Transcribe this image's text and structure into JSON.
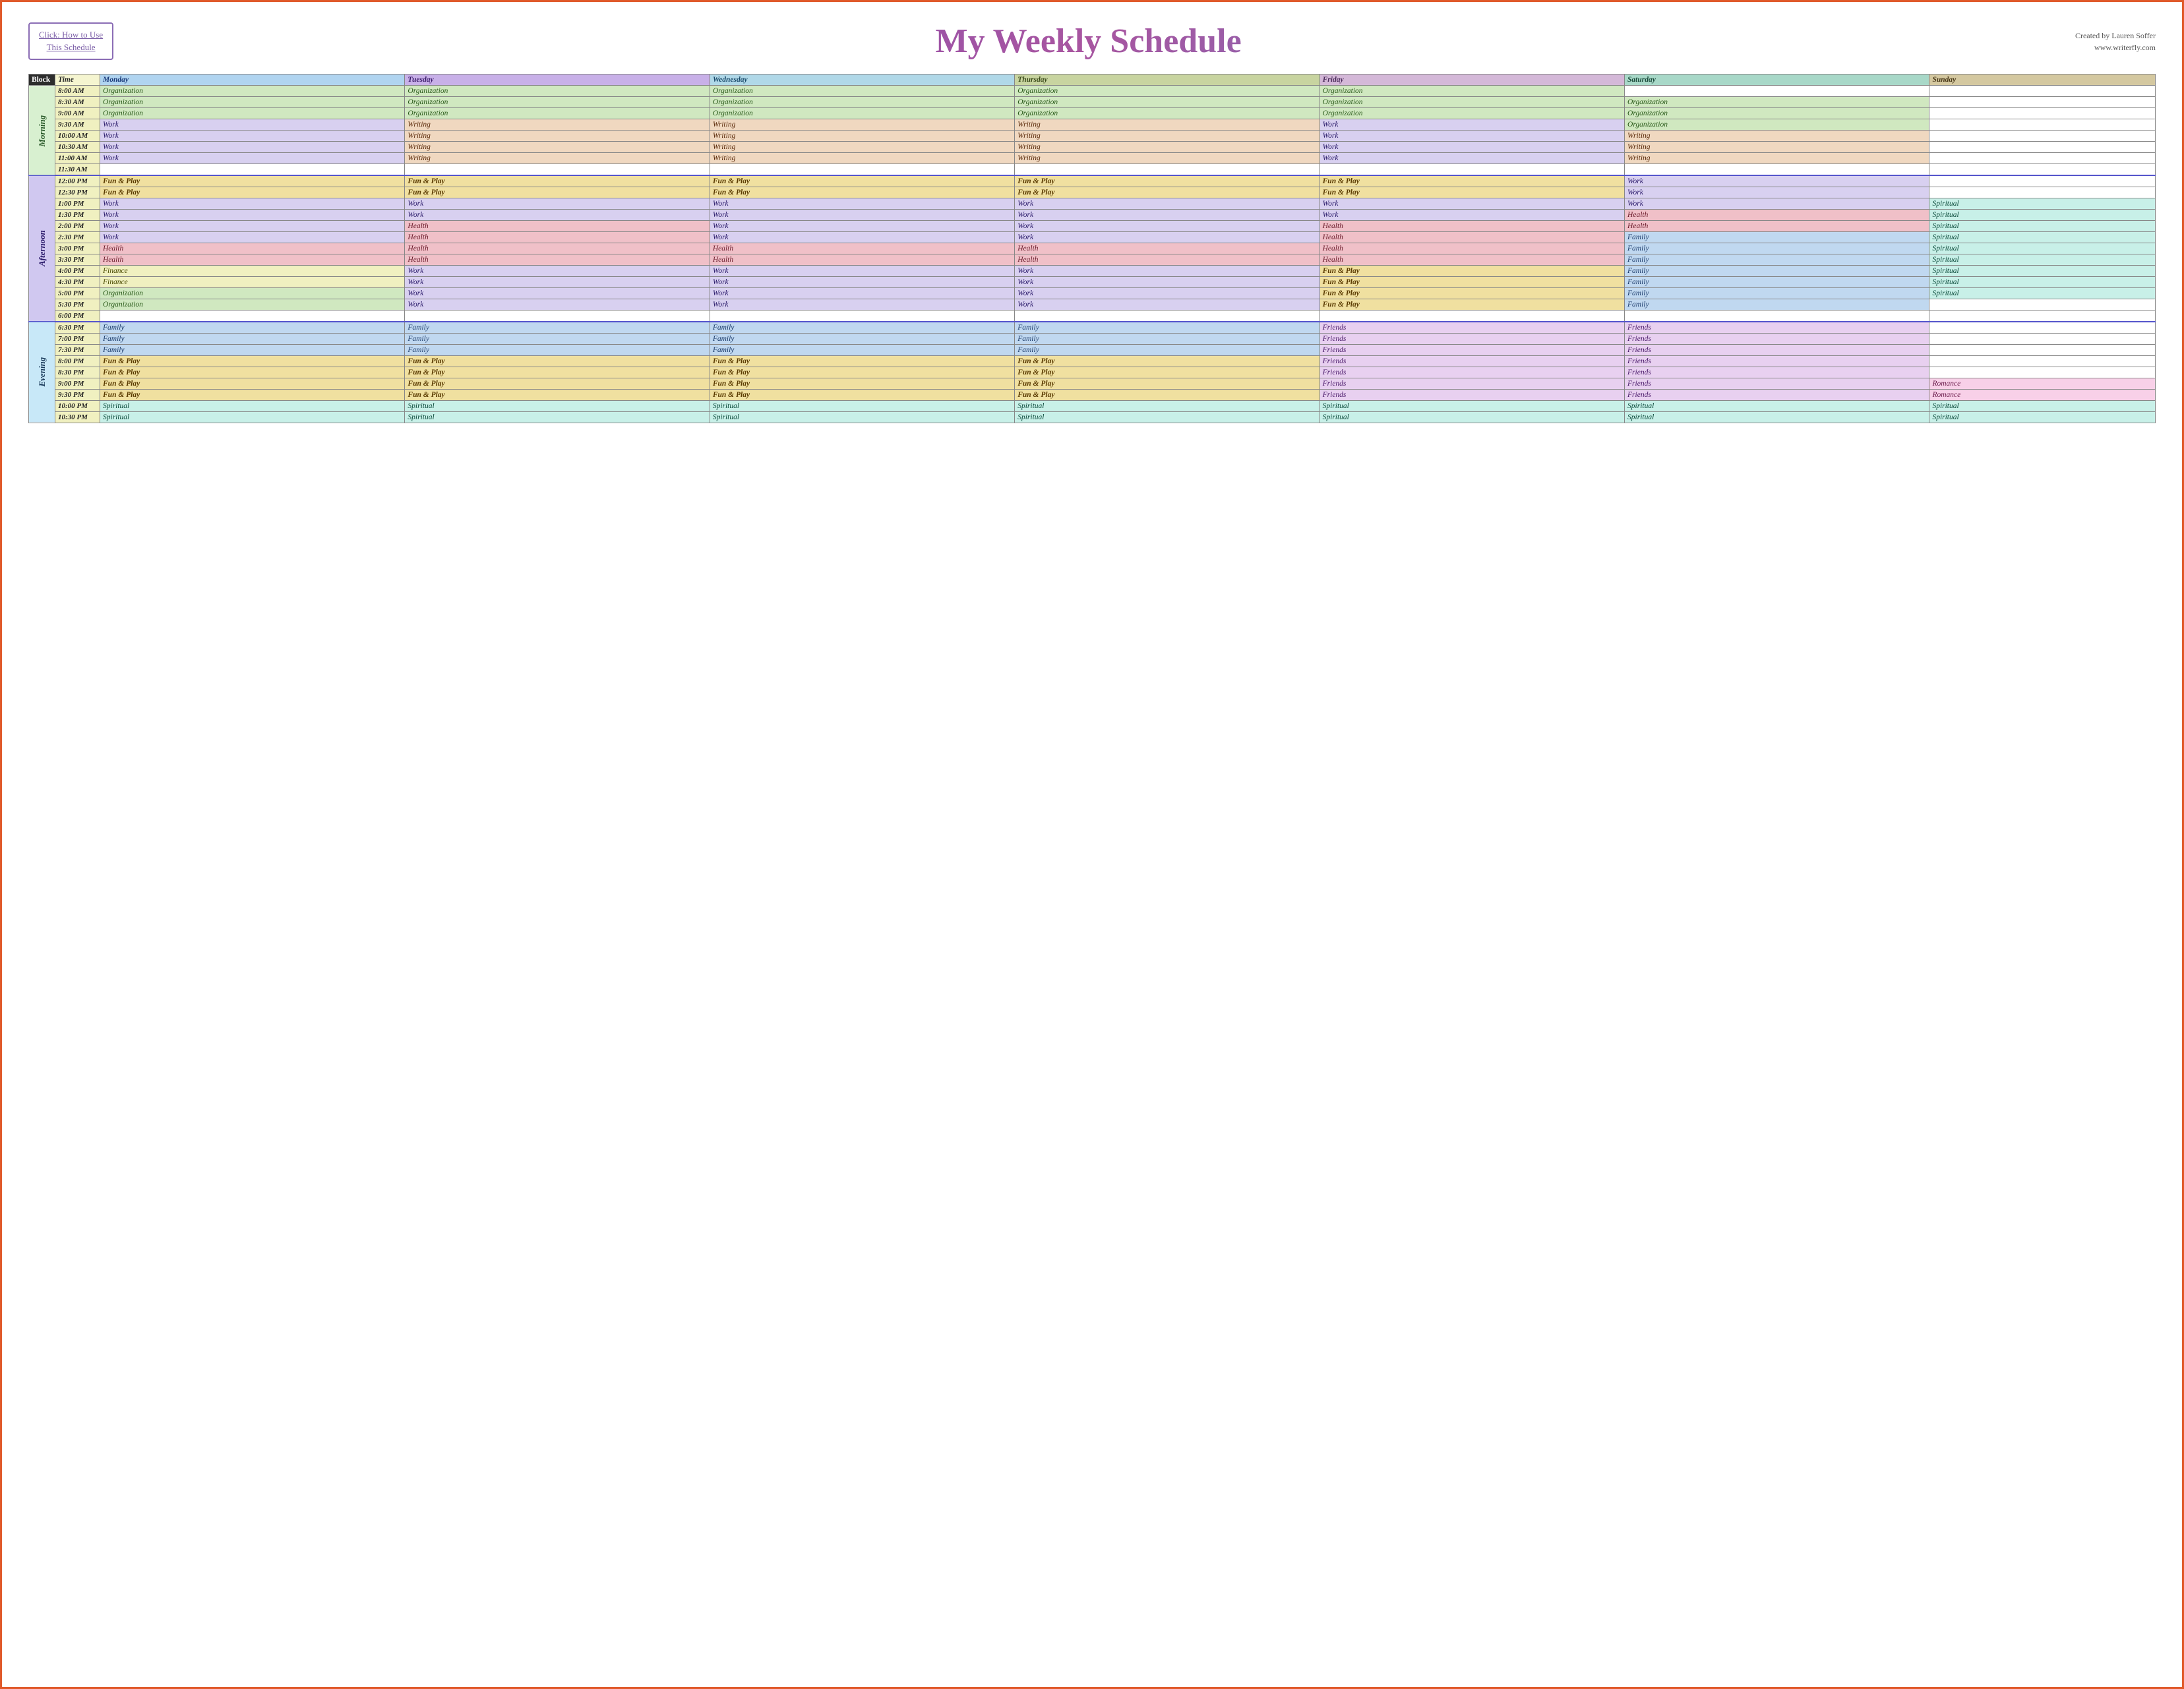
{
  "header": {
    "button_line1": "Click:  How to Use",
    "button_line2": "This Schedule",
    "title": "My Weekly Schedule",
    "credit_line1": "Created by Lauren Soffer",
    "credit_line2": "www.writerfly.com"
  },
  "table": {
    "headers": [
      "Block",
      "Time",
      "Monday",
      "Tuesday",
      "Wednesday",
      "Thursday",
      "Friday",
      "Saturday",
      "Sunday"
    ],
    "rows": [
      {
        "block": "Morning",
        "time": "8:00 AM",
        "mon": "Organization",
        "tue": "Organization",
        "wed": "Organization",
        "thu": "Organization",
        "fri": "Organization",
        "sat": "",
        "sun": ""
      },
      {
        "block": "",
        "time": "8:30 AM",
        "mon": "Organization",
        "tue": "Organization",
        "wed": "Organization",
        "thu": "Organization",
        "fri": "Organization",
        "sat": "Organization",
        "sun": ""
      },
      {
        "block": "",
        "time": "9:00 AM",
        "mon": "Organization",
        "tue": "Organization",
        "wed": "Organization",
        "thu": "Organization",
        "fri": "Organization",
        "sat": "Organization",
        "sun": ""
      },
      {
        "block": "",
        "time": "9:30 AM",
        "mon": "Work",
        "tue": "Writing",
        "wed": "Writing",
        "thu": "Writing",
        "fri": "Work",
        "sat": "Organization",
        "sun": ""
      },
      {
        "block": "",
        "time": "10:00 AM",
        "mon": "Work",
        "tue": "Writing",
        "wed": "Writing",
        "thu": "Writing",
        "fri": "Work",
        "sat": "Writing",
        "sun": ""
      },
      {
        "block": "",
        "time": "10:30 AM",
        "mon": "Work",
        "tue": "Writing",
        "wed": "Writing",
        "thu": "Writing",
        "fri": "Work",
        "sat": "Writing",
        "sun": ""
      },
      {
        "block": "",
        "time": "11:00 AM",
        "mon": "Work",
        "tue": "Writing",
        "wed": "Writing",
        "thu": "Writing",
        "fri": "Work",
        "sat": "Writing",
        "sun": ""
      },
      {
        "block": "",
        "time": "11:30 AM",
        "mon": "",
        "tue": "",
        "wed": "",
        "thu": "",
        "fri": "",
        "sat": "",
        "sun": ""
      },
      {
        "block": "Afternoon",
        "time": "12:00 PM",
        "mon": "Fun & Play",
        "tue": "Fun & Play",
        "wed": "Fun & Play",
        "thu": "Fun & Play",
        "fri": "Fun & Play",
        "sat": "Work",
        "sun": ""
      },
      {
        "block": "",
        "time": "12:30 PM",
        "mon": "Fun & Play",
        "tue": "Fun & Play",
        "wed": "Fun & Play",
        "thu": "Fun & Play",
        "fri": "Fun & Play",
        "sat": "Work",
        "sun": ""
      },
      {
        "block": "",
        "time": "1:00 PM",
        "mon": "Work",
        "tue": "Work",
        "wed": "Work",
        "thu": "Work",
        "fri": "Work",
        "sat": "Work",
        "sun": "Spiritual"
      },
      {
        "block": "",
        "time": "1:30 PM",
        "mon": "Work",
        "tue": "Work",
        "wed": "Work",
        "thu": "Work",
        "fri": "Work",
        "sat": "Health",
        "sun": "Spiritual"
      },
      {
        "block": "",
        "time": "2:00 PM",
        "mon": "Work",
        "tue": "Health",
        "wed": "Work",
        "thu": "Work",
        "fri": "Health",
        "sat": "Health",
        "sun": "Spiritual"
      },
      {
        "block": "",
        "time": "2:30 PM",
        "mon": "Work",
        "tue": "Health",
        "wed": "Work",
        "thu": "Work",
        "fri": "Health",
        "sat": "Family",
        "sun": "Spiritual"
      },
      {
        "block": "",
        "time": "3:00 PM",
        "mon": "Health",
        "tue": "Health",
        "wed": "Health",
        "thu": "Health",
        "fri": "Health",
        "sat": "Family",
        "sun": "Spiritual"
      },
      {
        "block": "",
        "time": "3:30 PM",
        "mon": "Health",
        "tue": "Health",
        "wed": "Health",
        "thu": "Health",
        "fri": "Health",
        "sat": "Family",
        "sun": "Spiritual"
      },
      {
        "block": "",
        "time": "4:00 PM",
        "mon": "Finance",
        "tue": "Work",
        "wed": "Work",
        "thu": "Work",
        "fri": "Fun & Play",
        "sat": "Family",
        "sun": "Spiritual"
      },
      {
        "block": "",
        "time": "4:30 PM",
        "mon": "Finance",
        "tue": "Work",
        "wed": "Work",
        "thu": "Work",
        "fri": "Fun & Play",
        "sat": "Family",
        "sun": "Spiritual"
      },
      {
        "block": "",
        "time": "5:00 PM",
        "mon": "Organization",
        "tue": "Work",
        "wed": "Work",
        "thu": "Work",
        "fri": "Fun & Play",
        "sat": "Family",
        "sun": "Spiritual"
      },
      {
        "block": "",
        "time": "5:30 PM",
        "mon": "Organization",
        "tue": "Work",
        "wed": "Work",
        "thu": "Work",
        "fri": "Fun & Play",
        "sat": "Family",
        "sun": ""
      },
      {
        "block": "",
        "time": "6:00 PM",
        "mon": "",
        "tue": "",
        "wed": "",
        "thu": "",
        "fri": "",
        "sat": "",
        "sun": ""
      },
      {
        "block": "Evening",
        "time": "6:30 PM",
        "mon": "Family",
        "tue": "Family",
        "wed": "Family",
        "thu": "Family",
        "fri": "Friends",
        "sat": "Friends",
        "sun": ""
      },
      {
        "block": "",
        "time": "7:00 PM",
        "mon": "Family",
        "tue": "Family",
        "wed": "Family",
        "thu": "Family",
        "fri": "Friends",
        "sat": "Friends",
        "sun": ""
      },
      {
        "block": "",
        "time": "7:30 PM",
        "mon": "Family",
        "tue": "Family",
        "wed": "Family",
        "thu": "Family",
        "fri": "Friends",
        "sat": "Friends",
        "sun": ""
      },
      {
        "block": "",
        "time": "8:00 PM",
        "mon": "Fun & Play",
        "tue": "Fun & Play",
        "wed": "Fun & Play",
        "thu": "Fun & Play",
        "fri": "Friends",
        "sat": "Friends",
        "sun": ""
      },
      {
        "block": "",
        "time": "8:30 PM",
        "mon": "Fun & Play",
        "tue": "Fun & Play",
        "wed": "Fun & Play",
        "thu": "Fun & Play",
        "fri": "Friends",
        "sat": "Friends",
        "sun": ""
      },
      {
        "block": "",
        "time": "9:00 PM",
        "mon": "Fun & Play",
        "tue": "Fun & Play",
        "wed": "Fun & Play",
        "thu": "Fun & Play",
        "fri": "Friends",
        "sat": "Friends",
        "sun": "Romance"
      },
      {
        "block": "",
        "time": "9:30 PM",
        "mon": "Fun & Play",
        "tue": "Fun & Play",
        "wed": "Fun & Play",
        "thu": "Fun & Play",
        "fri": "Friends",
        "sat": "Friends",
        "sun": "Romance"
      },
      {
        "block": "",
        "time": "10:00 PM",
        "mon": "Spiritual",
        "tue": "Spiritual",
        "wed": "Spiritual",
        "thu": "Spiritual",
        "fri": "Spiritual",
        "sat": "Spiritual",
        "sun": "Spiritual"
      },
      {
        "block": "",
        "time": "10:30 PM",
        "mon": "Spiritual",
        "tue": "Spiritual",
        "wed": "Spiritual",
        "thu": "Spiritual",
        "fri": "Spiritual",
        "sat": "Spiritual",
        "sun": "Spiritual"
      }
    ]
  }
}
